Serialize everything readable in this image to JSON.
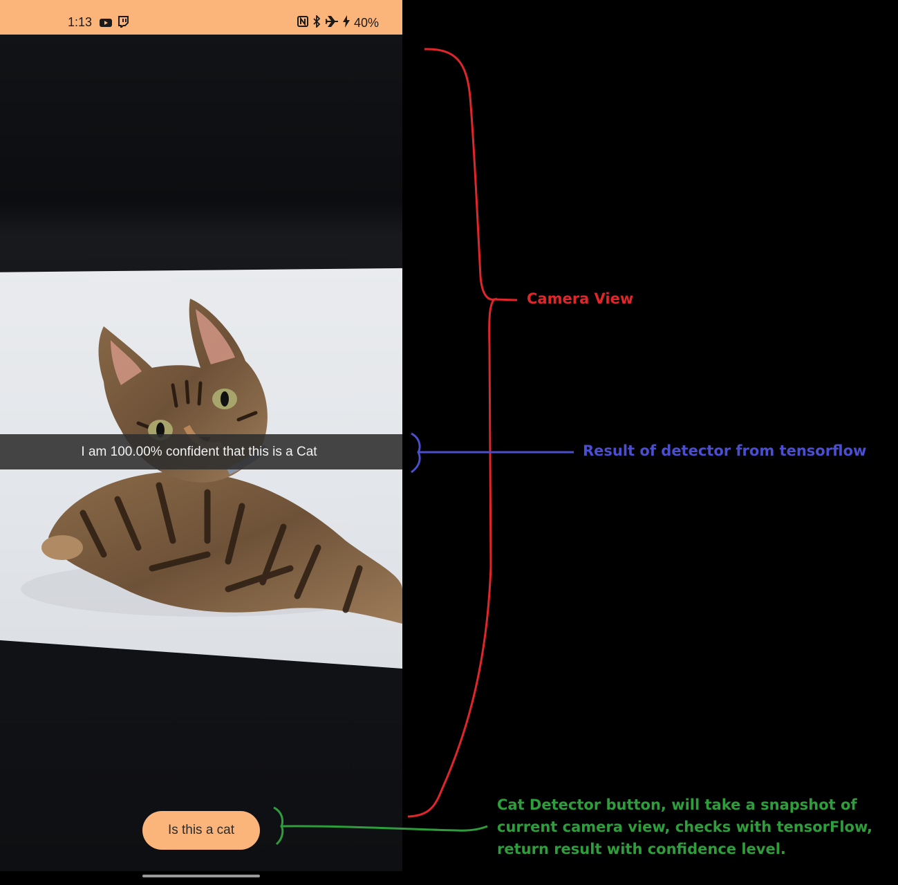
{
  "status_bar": {
    "time": "1:13",
    "battery": "40%",
    "icons": [
      "youtube-icon",
      "twitch-icon",
      "nfc-icon",
      "bluetooth-icon",
      "airplane-icon",
      "charging-icon"
    ]
  },
  "camera_view": {
    "result_text": "I am 100.00% confident that this is a Cat"
  },
  "button": {
    "label": "Is this a cat"
  },
  "annotations": {
    "camera_view": {
      "text": "Camera View",
      "color": "#e0252b"
    },
    "result": {
      "text": "Result of detector from tensorflow",
      "color": "#4a4ecf"
    },
    "button": {
      "text": "Cat Detector button, will take a snapshot of\ncurrent camera view, checks with tensorFlow,\nreturn result with confidence level.",
      "color": "#2e9e3c"
    }
  },
  "colors": {
    "accent": "#fbb57b",
    "result_banner": "#2d2d2d"
  }
}
